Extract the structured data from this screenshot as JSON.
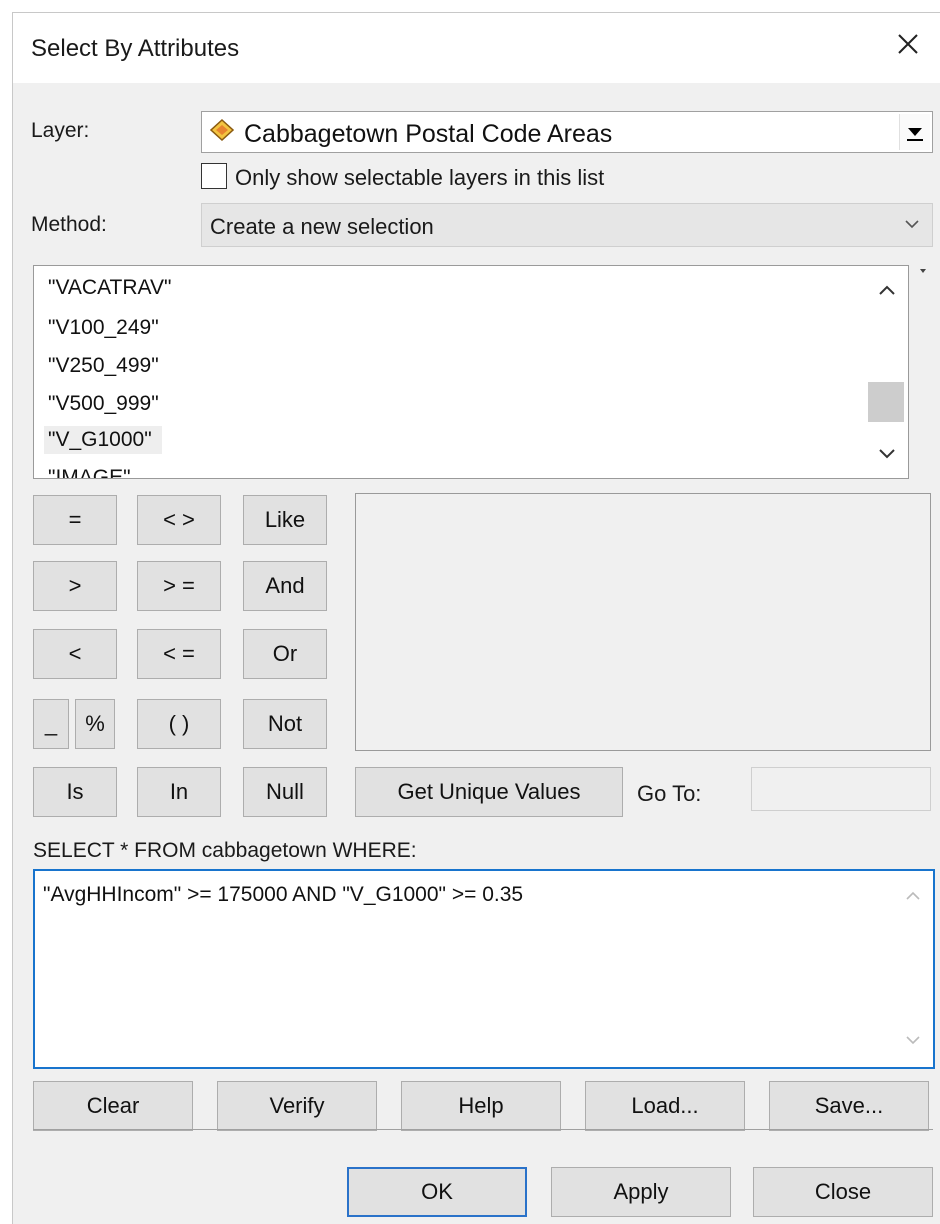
{
  "window": {
    "title": "Select By Attributes"
  },
  "layer": {
    "label": "Layer:",
    "value": "Cabbagetown Postal Code Areas",
    "checkbox_label": "Only show selectable layers in this list",
    "checkbox_checked": false
  },
  "method": {
    "label": "Method:",
    "value": "Create a new selection"
  },
  "fields": {
    "items": [
      "\"VACATRAV\"",
      "\"V100_249\"",
      "\"V250_499\"",
      "\"V500_999\"",
      "\"V_G1000\"",
      "\"IMAGE\""
    ],
    "selected": "\"V_G1000\""
  },
  "operators": {
    "eq": "=",
    "ne": "< >",
    "like": "Like",
    "gt": ">",
    "ge": "> =",
    "and": "And",
    "lt": "<",
    "le": "< =",
    "or": "Or",
    "underscore": "_",
    "percent": "%",
    "parens": "( )",
    "not": "Not",
    "is": "Is",
    "in": "In",
    "null": "Null"
  },
  "values": {
    "get_unique_label": "Get Unique Values",
    "goto_label": "Go To:",
    "goto_value": ""
  },
  "query": {
    "prefix": "SELECT * FROM cabbagetown WHERE:",
    "expression": "\"AvgHHIncom\" >= 175000 AND \"V_G1000\" >= 0.35"
  },
  "actions": {
    "clear": "Clear",
    "verify": "Verify",
    "help": "Help",
    "load": "Load...",
    "save": "Save..."
  },
  "footer": {
    "ok": "OK",
    "apply": "Apply",
    "close": "Close"
  },
  "colors": {
    "focus_border": "#1874cd",
    "dialog_bg": "#f0f0f0",
    "button_bg": "#e1e1e1"
  }
}
